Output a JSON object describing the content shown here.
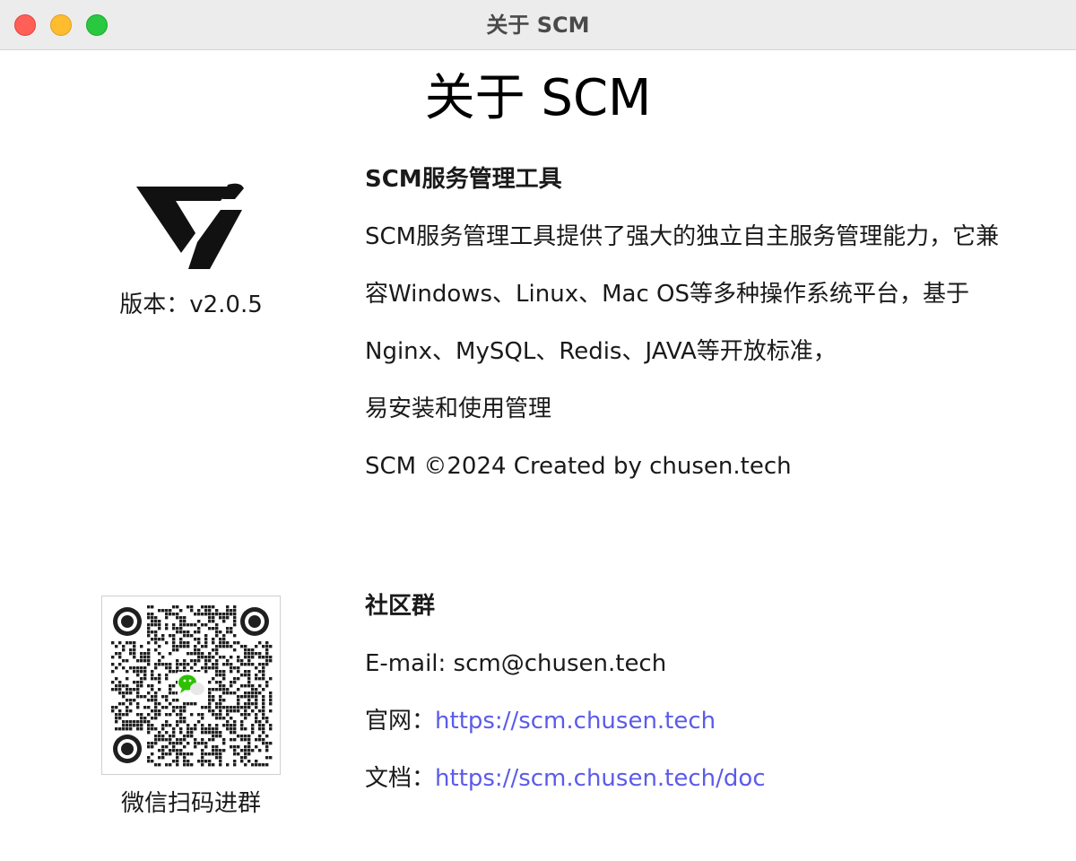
{
  "window": {
    "title": "关于 SCM"
  },
  "page": {
    "title": "关于 SCM"
  },
  "app": {
    "version_label": "版本：v2.0.5"
  },
  "about": {
    "heading": "SCM服务管理工具",
    "description_lines": [
      "SCM服务管理工具提供了强大的独立自主服务管理能力，它兼",
      "容Windows、Linux、Mac OS等多种操作系统平台，基于",
      "Nginx、MySQL、Redis、JAVA等开放标准，",
      "易安装和使用管理"
    ],
    "copyright": "SCM ©2024 Created by chusen.tech"
  },
  "community": {
    "heading": "社区群",
    "email_line": "E-mail: scm@chusen.tech",
    "website_label": "官网：",
    "website_url": "https://scm.chusen.tech",
    "docs_label": "文档：",
    "docs_url": "https://scm.chusen.tech/doc",
    "qr_caption": "微信扫码进群"
  },
  "icons": {
    "logo": "scm-logo-icon",
    "qr": "wechat-qr-code",
    "wechat": "wechat-icon"
  },
  "colors": {
    "link": "#5b5bea",
    "close": "#ff5f57",
    "minimize": "#febc2e",
    "maximize": "#28c840",
    "wechat_green": "#2dc100"
  }
}
